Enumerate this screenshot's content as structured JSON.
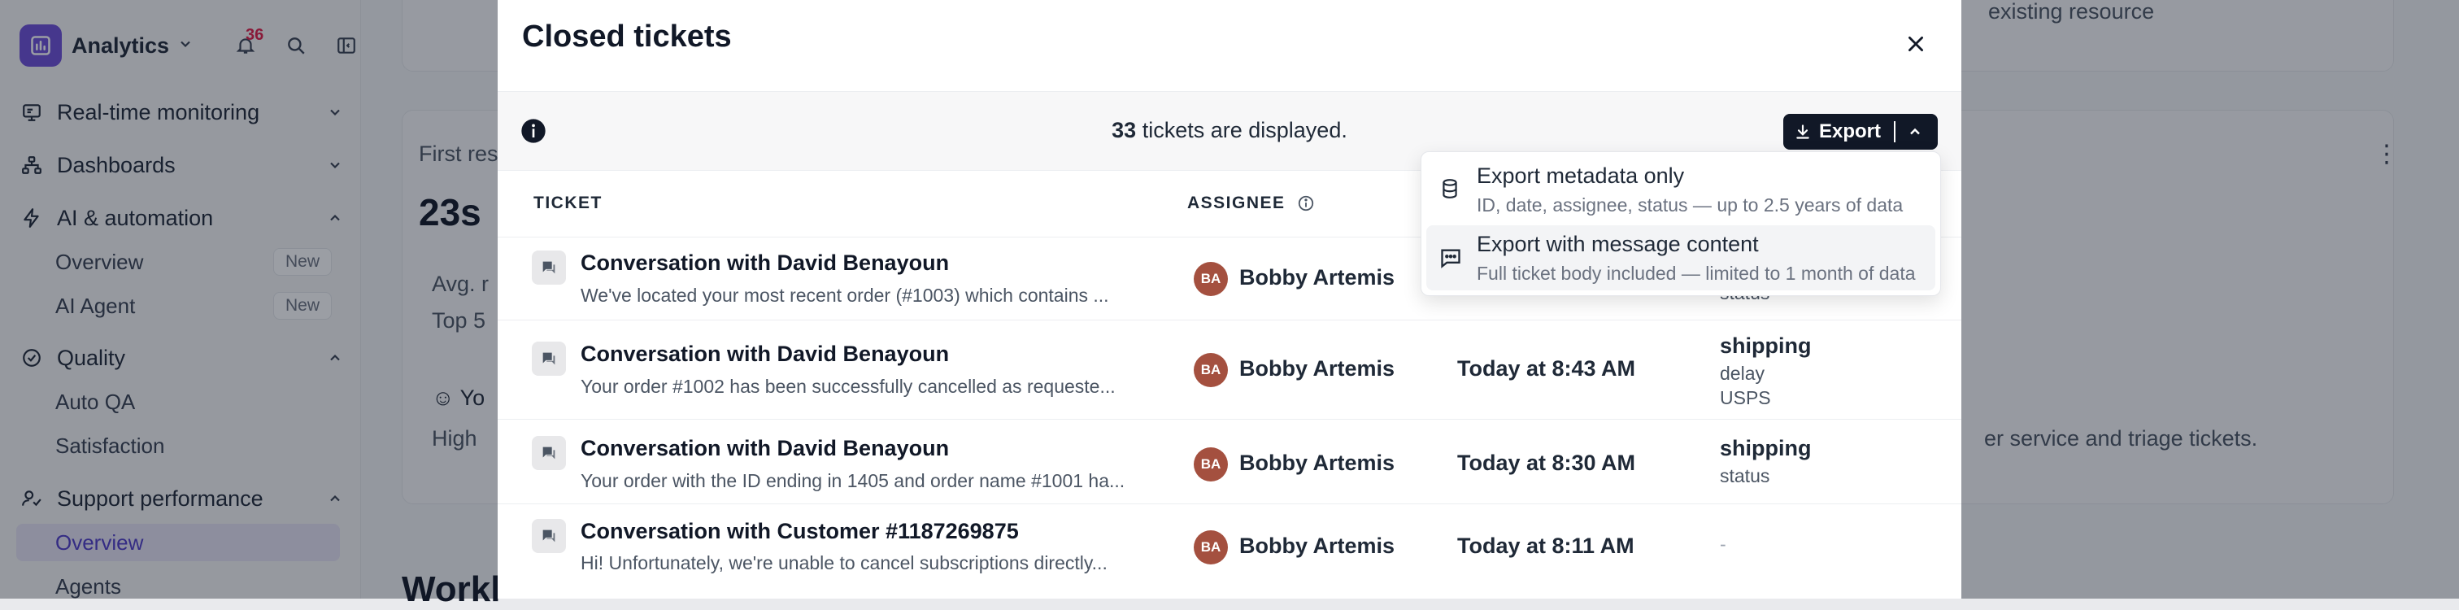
{
  "app": {
    "name": "Analytics",
    "notifications": "36"
  },
  "sidebar": {
    "sections": [
      {
        "label": "Real-time monitoring"
      },
      {
        "label": "Dashboards"
      },
      {
        "label": "AI & automation"
      },
      {
        "label": "Quality"
      },
      {
        "label": "Support performance"
      }
    ],
    "items": [
      {
        "label": "Overview",
        "badge": "New"
      },
      {
        "label": "AI Agent",
        "badge": "New"
      },
      {
        "label": "Auto QA"
      },
      {
        "label": "Satisfaction"
      },
      {
        "label": "Overview"
      },
      {
        "label": "Agents"
      }
    ]
  },
  "background": {
    "top_card_text": "existing resource",
    "metric_label": "First res",
    "metric_value": "23s",
    "avg_label": "Avg. r",
    "top_label": "Top 5",
    "yo_label": "Yo",
    "high_label": "High",
    "triage_text": "er service and triage tickets.",
    "status_peek": "status",
    "workload_peek": "Workl"
  },
  "modal": {
    "title": "Closed tickets",
    "count": "33",
    "count_suffix": "tickets are displayed.",
    "export_label": "Export",
    "columns": {
      "ticket": "TICKET",
      "assignee": "ASSIGNEE"
    },
    "export_menu": [
      {
        "title": "Export metadata only",
        "subtitle": "ID, date, assignee, status — up to 2.5 years of data"
      },
      {
        "title": "Export with message content",
        "subtitle": "Full ticket body included — limited to 1 month of data"
      }
    ],
    "rows": [
      {
        "title": "Conversation with David Benayoun",
        "preview": "We've located your most recent order (#1003) which contains ...",
        "initials": "BA",
        "assignee": "Bobby Artemis",
        "date": "",
        "tag": "",
        "sub1": "status",
        "sub2": ""
      },
      {
        "title": "Conversation with David Benayoun",
        "preview": "Your order #1002 has been successfully cancelled as requeste...",
        "initials": "BA",
        "assignee": "Bobby Artemis",
        "date": "Today at 8:43 AM",
        "tag": "shipping",
        "sub1": "delay",
        "sub2": "USPS"
      },
      {
        "title": "Conversation with David Benayoun",
        "preview": "Your order with the ID ending in 1405 and order name #1001 ha...",
        "initials": "BA",
        "assignee": "Bobby Artemis",
        "date": "Today at 8:30 AM",
        "tag": "shipping",
        "sub1": "status",
        "sub2": ""
      },
      {
        "title": "Conversation with Customer #1187269875",
        "preview": "Hi! Unfortunately, we're unable to cancel subscriptions directly...",
        "initials": "BA",
        "assignee": "Bobby Artemis",
        "date": "Today at 8:11 AM",
        "tag": "-",
        "sub1": "",
        "sub2": ""
      }
    ]
  }
}
